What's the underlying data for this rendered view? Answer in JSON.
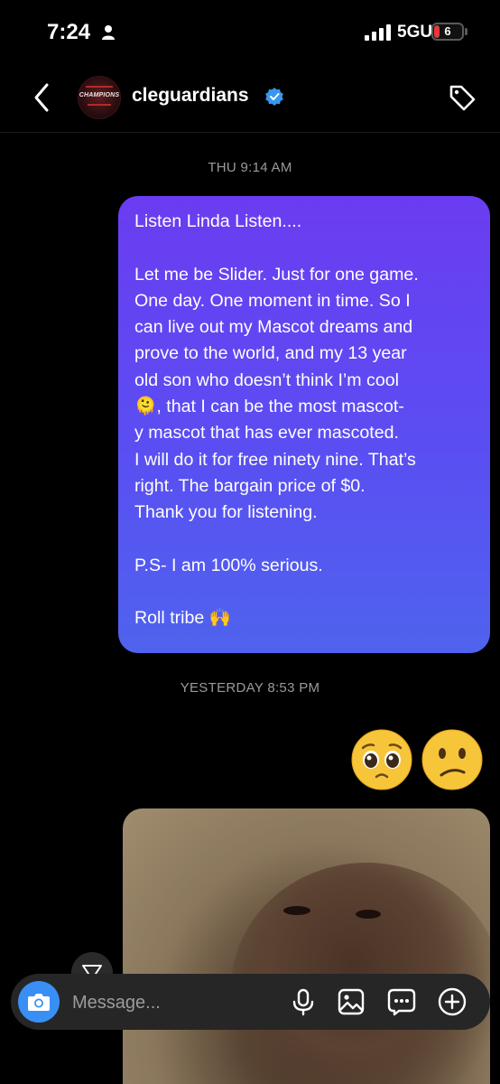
{
  "status_bar": {
    "time": "7:24",
    "network": "5GUC",
    "battery_level": "6",
    "battery_color": "#e23b3b"
  },
  "header": {
    "username": "cleguardians",
    "avatar_text": "CHAMPIONS",
    "verified": true,
    "accent": "#3897f0"
  },
  "conversation": {
    "timestamp_1": "THU 9:14 AM",
    "message_lines": [
      "Listen Linda Listen....",
      "",
      "Let me be Slider. Just for one game.",
      "One day. One moment in time. So I",
      "can live out my Mascot dreams and",
      "prove to the world, and my 13 year",
      "old son who doesn’t think I’m cool",
      "🫠, that I can be the most mascot-",
      "y mascot that has ever mascoted.",
      "I will do it for free ninety nine. That’s",
      "right. The bargain price of $0.",
      "Thank you for listening.",
      "",
      "P.S- I am 100% serious.",
      "",
      "Roll tribe 🙌"
    ],
    "timestamp_2": "YESTERDAY 8:53 PM",
    "reaction_emojis": [
      "pleading-face",
      "confused-face"
    ],
    "bubble_gradient": [
      "#6b3cf1",
      "#4f63ee"
    ]
  },
  "composer": {
    "placeholder": "Message...",
    "icons": [
      "camera-icon",
      "microphone-icon",
      "gallery-icon",
      "sticker-icon",
      "plus-icon"
    ]
  }
}
